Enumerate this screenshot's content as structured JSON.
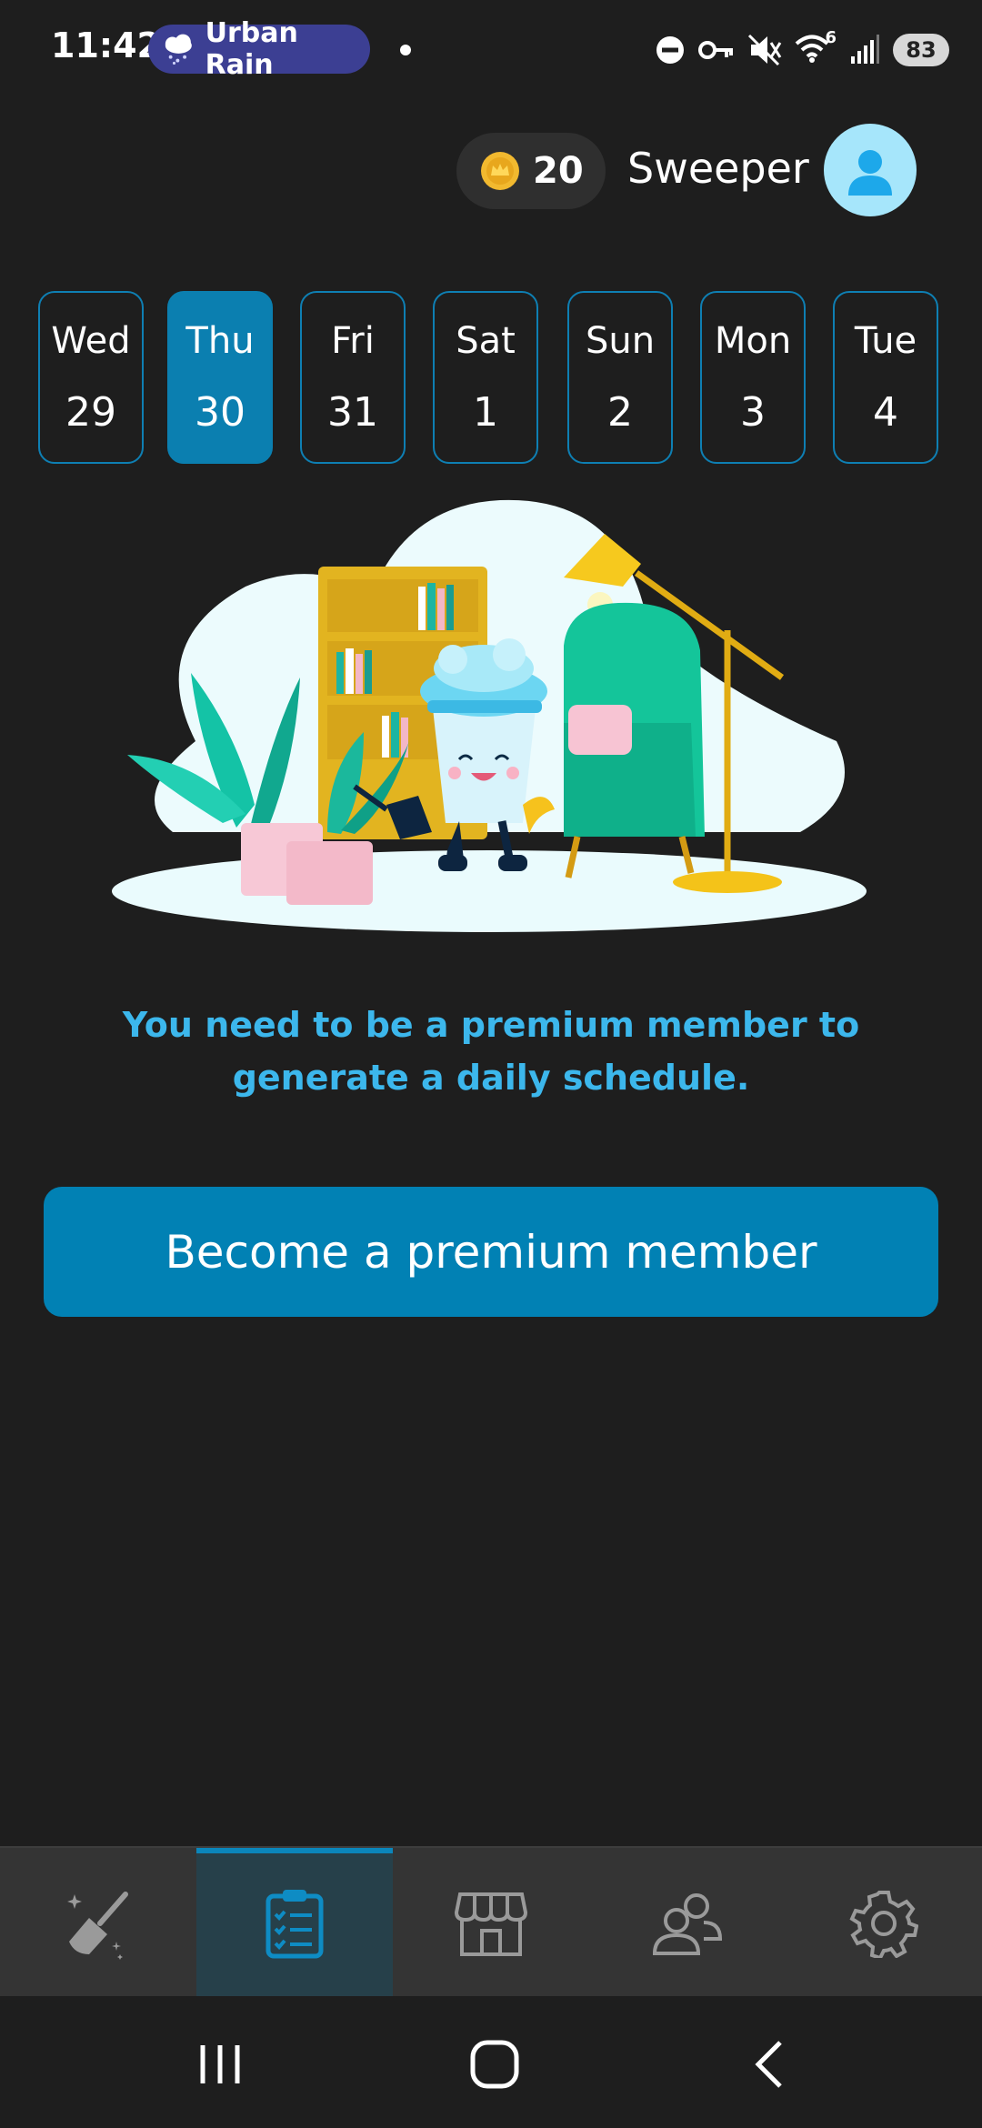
{
  "status_bar": {
    "time": "11:42",
    "weather_label": "Urban Rain",
    "wifi_superscript": "6",
    "battery": "83"
  },
  "header": {
    "coins": "20",
    "username": "Sweeper"
  },
  "days": [
    {
      "name": "Wed",
      "num": "29",
      "selected": false
    },
    {
      "name": "Thu",
      "num": "30",
      "selected": true
    },
    {
      "name": "Fri",
      "num": "31",
      "selected": false
    },
    {
      "name": "Sat",
      "num": "1",
      "selected": false
    },
    {
      "name": "Sun",
      "num": "2",
      "selected": false
    },
    {
      "name": "Mon",
      "num": "3",
      "selected": false
    },
    {
      "name": "Tue",
      "num": "4",
      "selected": false
    }
  ],
  "message": "You need to be a premium member to generate a daily schedule.",
  "cta_label": "Become a premium member",
  "bottom_nav": [
    {
      "icon": "broom-icon",
      "active": false
    },
    {
      "icon": "clipboard-checklist-icon",
      "active": true
    },
    {
      "icon": "store-icon",
      "active": false
    },
    {
      "icon": "people-icon",
      "active": false
    },
    {
      "icon": "gear-icon",
      "active": false
    }
  ],
  "colors": {
    "background": "#1e1e1e",
    "accent": "#0181b4",
    "message_text": "#3cb7ec",
    "weather_pill": "#3c3f93"
  }
}
